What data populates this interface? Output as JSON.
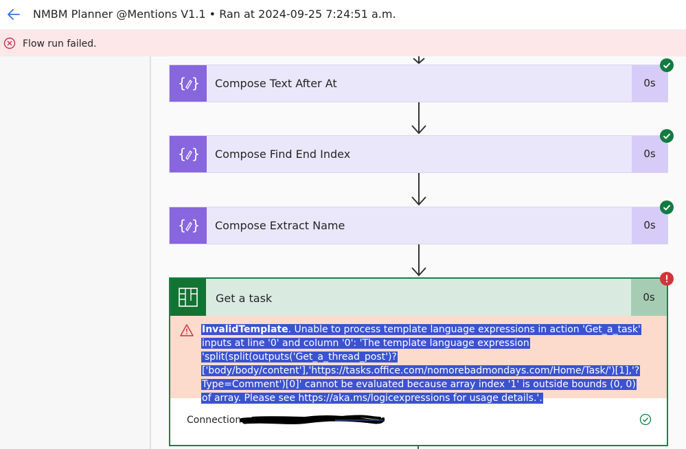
{
  "header": {
    "title": "NMBM Planner @Mentions V1.1 • Ran at 2024-09-25 7:24:51 a.m.",
    "back_icon": "arrow-left-icon"
  },
  "banner": {
    "text": "Flow run failed.",
    "icon": "error-circle-icon",
    "color": "#fde7e9"
  },
  "steps": [
    {
      "label": "Compose Text After At",
      "duration": "0s",
      "status": "succeeded",
      "icon": "compose-icon"
    },
    {
      "label": "Compose Find End Index",
      "duration": "0s",
      "status": "succeeded",
      "icon": "compose-icon"
    },
    {
      "label": "Compose Extract Name",
      "duration": "0s",
      "status": "succeeded",
      "icon": "compose-icon"
    }
  ],
  "failed_step": {
    "label": "Get a task",
    "duration": "0s",
    "status": "failed",
    "icon": "planner-icon",
    "error_title": "InvalidTemplate",
    "error_message": ". Unable to process template language expressions in action 'Get_a_task' inputs at line '0' and column '0': 'The template language expression 'split(split(outputs('Get_a_thread_post')?['body/body/content'],'https://tasks.office.com/nomorebadmondays.com/Home/Task/')[1],'?Type=Comment')[0]' cannot be evaluated because array index '1' is outside bounds (0, 0) of array. Please see https://aka.ms/logicexpressions for usage details.'.",
    "connection_label": "Connection:"
  },
  "colors": {
    "compose_accent": "#8766de",
    "planner_accent": "#137333",
    "success": "#107c41",
    "error": "#d13438"
  }
}
